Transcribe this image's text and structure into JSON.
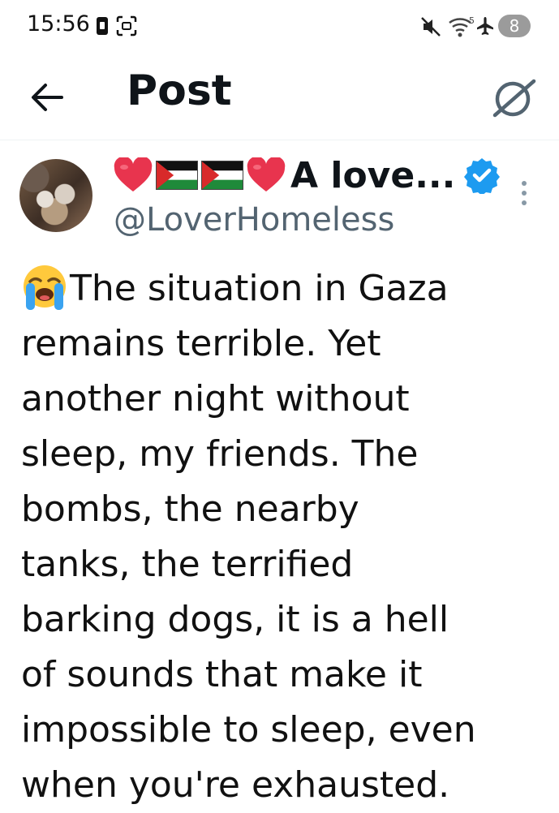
{
  "status_bar": {
    "time": "15:56",
    "battery_level": "8",
    "icons": [
      "sim-card-icon",
      "screenshot-icon",
      "mute-icon",
      "wifi-icon",
      "airplane-icon"
    ],
    "wifi_label": "5"
  },
  "app_bar": {
    "title": "Post",
    "back_icon": "arrow-left-icon",
    "grok_icon": "grok-icon"
  },
  "post": {
    "author": {
      "name_prefix_emojis": [
        "red-heart",
        "palestine-flag",
        "palestine-flag",
        "red-heart"
      ],
      "display_name": "A love...",
      "handle": "@LoverHomeless",
      "verified": true
    },
    "lead_emoji": "loudly-crying-face",
    "text_lines": [
      "The situation in Gaza",
      "remains terrible. Yet",
      "another night without",
      "sleep, my friends. The",
      "bombs, the nearby",
      "tanks, the terrified",
      "barking dogs, it is a hell",
      "of sounds that make it",
      "impossible to sleep, even",
      "when you're exhausted."
    ]
  },
  "colors": {
    "text_primary": "#0f1419",
    "text_secondary": "#536471",
    "verified_blue": "#1d9bf0",
    "heart_red": "#e8344e",
    "divider": "#eff3f4"
  }
}
